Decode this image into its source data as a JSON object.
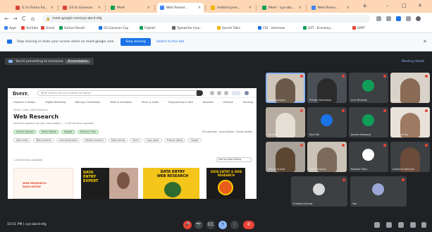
{
  "tabs": [
    {
      "label": "G Sri Rama Ra...",
      "fav": "#db4437"
    },
    {
      "label": "GS Sr Ganesan",
      "fav": "#db4437"
    },
    {
      "label": "Meet",
      "fav": "#0f9d58"
    },
    {
      "label": "Web Resear...",
      "fav": "#4285f4"
    },
    {
      "label": "Untitled pres...",
      "fav": "#f4b400"
    },
    {
      "label": "Meet - xyz-abc...",
      "fav": "#0f9d58"
    },
    {
      "label": "Web Resea...",
      "fav": "#4285f4"
    }
  ],
  "active_tab_index": 3,
  "new_tab_symbol": "+",
  "window_controls": {
    "minimize": "–",
    "maximize": "□",
    "close": "✕"
  },
  "toolbar": {
    "back": "←",
    "forward": "→",
    "reload": "C",
    "home": "⌂",
    "url": "meet.google.com/xyz-abcd-efg"
  },
  "bookmarks": [
    {
      "label": "Apps",
      "fav": "#4285f4"
    },
    {
      "label": "YouTube",
      "fav": "#ea4335"
    },
    {
      "label": "Gmail",
      "fav": "#db4437"
    },
    {
      "label": "Sarkari Result",
      "fav": "#0f9d58"
    },
    {
      "label": "GS Ganesan Cap",
      "fav": "#1a73e8"
    },
    {
      "label": "Flipkart",
      "fav": "#0f9d58"
    },
    {
      "label": "Typewriter Inpu...",
      "fav": "#5f6368"
    },
    {
      "label": "Suresh Talks",
      "fav": "#f4b400"
    },
    {
      "label": "CGI - Interview",
      "fav": "#1a73e8"
    },
    {
      "label": "GST - Economy...",
      "fav": "#0f9d58"
    },
    {
      "label": "GMIT",
      "fav": "#ea4335"
    }
  ],
  "infobar": {
    "text": "Stop sharing or mute your screen share on meet.google.com",
    "button": "Stop sharing",
    "link": "Switch to this tab",
    "close": "✕"
  },
  "meet": {
    "presenter_text": "You're presenting to everyone",
    "presenter_tag": "Presentation",
    "corner_text": "Meeting details",
    "time": "10:51 PM | xyz-abcd-efg"
  },
  "shared": {
    "logo": "fiverr.",
    "search_placeholder": "What service are you looking for today?",
    "categories": [
      "Graphics & Design",
      "Digital Marketing",
      "Writing & Translation",
      "Video & Animation",
      "Music & Audio",
      "Programming & Tech",
      "Business",
      "Lifestyle",
      "Trending"
    ],
    "breadcrumb": "Home / Data / Web Research",
    "title": "Web Research",
    "results_text": "Get fresh research for your next project — 1,234 services available",
    "filter_row1": [
      "Service Options",
      "Seller Details",
      "Budget",
      "Delivery Time"
    ],
    "filter_row1_right": "Pro services  ·  Local sellers  ·  Online sellers",
    "filter_row2": [
      "Data entry",
      "Web research",
      "Lead generation",
      "Market research",
      "Data mining",
      "Excel",
      "Copy paste",
      "Product listing",
      "Google"
    ],
    "clear_text": "1,234 services available",
    "sort_text": "Sort by: Best Selling",
    "thumb1_text": "WEB RESEARCH\nDATA ENTRY",
    "thumb2_text": "DATA\nENTRY\nEXPERT",
    "thumb3_text": "DATA ENTRY\nWEB RESEARCH",
    "thumb4_text": "DATA ENTRY & WEB RESEARCH"
  },
  "participants": [
    {
      "name": "Vijay Narayan",
      "kind": "person",
      "color": "#6b5a4a",
      "bg": "#cfc5b8",
      "speaking": true
    },
    {
      "name": "Prinaa Srinivasan",
      "kind": "person",
      "color": "#2b2b2b",
      "bg": "#4a4f56"
    },
    {
      "name": "Arul Dhanraj",
      "kind": "avatar",
      "color": "#0f9d58",
      "bg": "#3c4043"
    },
    {
      "name": "Balaji",
      "kind": "person",
      "color": "#8a6b55",
      "bg": "#d9d2c8"
    },
    {
      "name": "Kavitha",
      "kind": "person",
      "color": "#e6dfd6",
      "bg": "#b7aca0"
    },
    {
      "name": "Ravi MV",
      "kind": "avatar",
      "color": "#1a73e8",
      "bg": "#3c4043"
    },
    {
      "name": "Jeevan Kamaraj",
      "kind": "avatar",
      "color": "#0f9d58",
      "bg": "#3c4043"
    },
    {
      "name": "Sowmya Raj",
      "kind": "person",
      "color": "#9e7a63",
      "bg": "#e8e2da"
    },
    {
      "name": "Mohan Kumar",
      "kind": "person",
      "color": "#5c4632",
      "bg": "#a8a29a"
    },
    {
      "name": "Selvi Prakash",
      "kind": "person",
      "color": "#7d6a5a",
      "bg": "#cbc3b7"
    },
    {
      "name": "Ramesh Raju",
      "kind": "avatar",
      "color": "#ffffff",
      "bg": "#3c4043"
    },
    {
      "name": "Lakshmi Narayan",
      "kind": "person",
      "color": "#6b4b3a",
      "bg": "#3c4043"
    },
    {
      "name": "Pradeep Kumar",
      "kind": "avatar",
      "color": "#d9d9d9",
      "bg": "#3c4043"
    },
    {
      "name": "You",
      "kind": "avatar",
      "color": "#9aa7d6",
      "bg": "#3c4043"
    }
  ],
  "controls": [
    "mic-off",
    "cam-off",
    "captions",
    "present",
    "more"
  ],
  "control_glyphs": [
    "🎤",
    "📷",
    "CC",
    "↑",
    "⋮"
  ],
  "end_call_glyph": "✆"
}
